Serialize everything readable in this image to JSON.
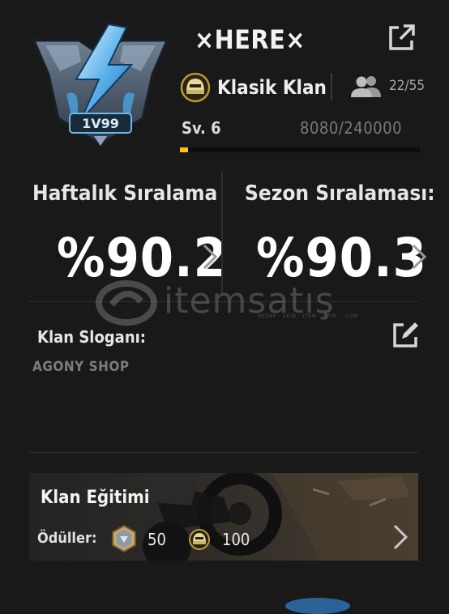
{
  "clan": {
    "name": "×HERE×",
    "emblem_text": "1V99",
    "type_label": "Klasik Klan",
    "members": "22/55",
    "level_label": "Sv. 6",
    "xp_label": "8080/240000",
    "xp_progress": 0.034
  },
  "ranking": {
    "weekly_title": "Haftalık Sıralama",
    "weekly_value": "%90.2",
    "season_title": "Sezon Sıralaması:",
    "season_value": "%90.3"
  },
  "slogan": {
    "title": "Klan Sloganı:",
    "text": "AGONY SHOP"
  },
  "training": {
    "title": "Klan Eğitimi",
    "rewards_label": "Ödüller:",
    "reward1_value": "50",
    "reward2_value": "100"
  },
  "watermark": {
    "text": "itemsatış",
    "sub": "HESAP · SKIN · ITEM · EPIN · .COM"
  },
  "icons": {
    "share": "share-icon",
    "helmet": "helmet-icon",
    "members": "members-icon",
    "edit": "edit-icon",
    "chevron": "chevron-right-icon",
    "reward_badge": "badge-icon",
    "reward_helmet": "helmet-icon"
  },
  "colors": {
    "background": "#191919",
    "accent_progress": "#f5c518",
    "text_primary": "#ffffff",
    "text_muted": "#7a7a7a"
  }
}
